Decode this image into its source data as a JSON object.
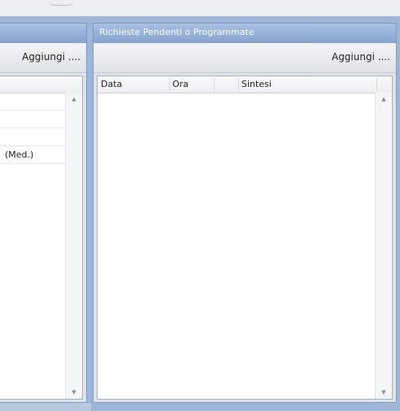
{
  "left_panel": {
    "add_button_label": "Aggiungi ....",
    "rows": [
      "",
      "",
      "",
      "(Med.)"
    ]
  },
  "right_panel": {
    "title": "Richieste Pendenti o Programmate",
    "add_button_label": "Aggiungi ....",
    "columns": [
      "Data",
      "Ora",
      "",
      "Sintesi"
    ]
  },
  "icons": {
    "scroll_up": "triangle-up",
    "scroll_down": "triangle-down"
  },
  "colors": {
    "panel_header": "#97b1d9",
    "panel_border": "#7f99c0",
    "background": "#9eb6d8"
  }
}
